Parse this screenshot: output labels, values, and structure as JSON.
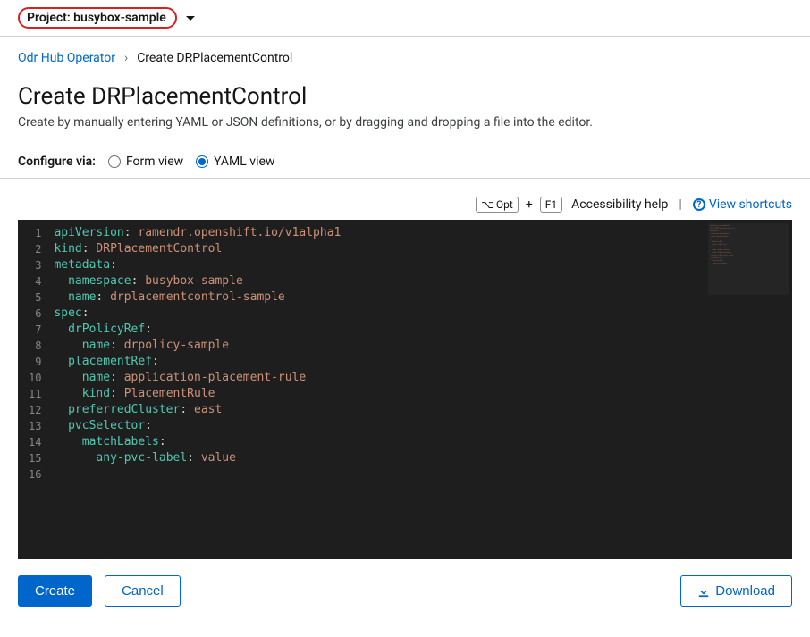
{
  "project": {
    "prefix": "Project:",
    "name": "busybox-sample"
  },
  "breadcrumb": {
    "parent": "Odr Hub Operator",
    "current": "Create DRPlacementControl"
  },
  "page": {
    "title": "Create DRPlacementControl",
    "subtitle": "Create by manually entering YAML or JSON definitions, or by dragging and dropping a file into the editor."
  },
  "configure": {
    "label": "Configure via:",
    "formView": "Form view",
    "yamlView": "YAML view",
    "selected": "yaml"
  },
  "toolbar": {
    "opt": "⌥ Opt",
    "plus": "+",
    "f1": "F1",
    "accessibility": "Accessibility help",
    "sep": "|",
    "shortcuts": "View shortcuts"
  },
  "gutterCount": 16,
  "code": {
    "lines": [
      [
        [
          "key",
          "apiVersion"
        ],
        [
          "punc",
          ": "
        ],
        [
          "str",
          "ramendr.openshift.io/v1alpha1"
        ]
      ],
      [
        [
          "key",
          "kind"
        ],
        [
          "punc",
          ": "
        ],
        [
          "str",
          "DRPlacementControl"
        ]
      ],
      [
        [
          "key",
          "metadata"
        ],
        [
          "punc",
          ":"
        ]
      ],
      [
        [
          "punc",
          "  "
        ],
        [
          "key",
          "namespace"
        ],
        [
          "punc",
          ": "
        ],
        [
          "str",
          "busybox-sample"
        ]
      ],
      [
        [
          "punc",
          "  "
        ],
        [
          "key",
          "name"
        ],
        [
          "punc",
          ": "
        ],
        [
          "str",
          "drplacementcontrol-sample"
        ]
      ],
      [
        [
          "key",
          "spec"
        ],
        [
          "punc",
          ":"
        ]
      ],
      [
        [
          "punc",
          "  "
        ],
        [
          "key",
          "drPolicyRef"
        ],
        [
          "punc",
          ":"
        ]
      ],
      [
        [
          "punc",
          "    "
        ],
        [
          "key",
          "name"
        ],
        [
          "punc",
          ": "
        ],
        [
          "str",
          "drpolicy-sample"
        ]
      ],
      [
        [
          "punc",
          "  "
        ],
        [
          "key",
          "placementRef"
        ],
        [
          "punc",
          ":"
        ]
      ],
      [
        [
          "punc",
          "    "
        ],
        [
          "key",
          "name"
        ],
        [
          "punc",
          ": "
        ],
        [
          "str",
          "application-placement-rule"
        ]
      ],
      [
        [
          "punc",
          "    "
        ],
        [
          "key",
          "kind"
        ],
        [
          "punc",
          ": "
        ],
        [
          "str",
          "PlacementRule"
        ]
      ],
      [
        [
          "punc",
          "  "
        ],
        [
          "key",
          "preferredCluster"
        ],
        [
          "punc",
          ": "
        ],
        [
          "str",
          "east"
        ]
      ],
      [
        [
          "punc",
          "  "
        ],
        [
          "key",
          "pvcSelector"
        ],
        [
          "punc",
          ":"
        ]
      ],
      [
        [
          "punc",
          "    "
        ],
        [
          "key",
          "matchLabels"
        ],
        [
          "punc",
          ":"
        ]
      ],
      [
        [
          "punc",
          "      "
        ],
        [
          "key",
          "any-pvc-label"
        ],
        [
          "punc",
          ": "
        ],
        [
          "str",
          "value"
        ]
      ],
      []
    ]
  },
  "buttons": {
    "create": "Create",
    "cancel": "Cancel",
    "download": "Download"
  }
}
